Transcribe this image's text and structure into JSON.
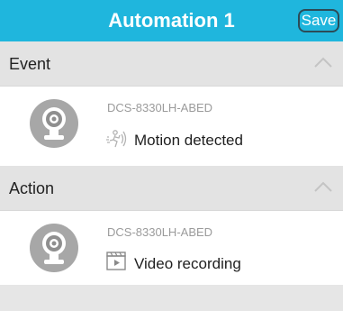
{
  "header": {
    "title": "Automation 1",
    "save_label": "Save",
    "background_color": "#1fb6dd"
  },
  "event_section": {
    "label": "Event",
    "collapse_icon": "chevron-up-icon",
    "item": {
      "device": "DCS-8330LH-ABED",
      "detail": "Motion detected",
      "icon": "motion-icon",
      "avatar_icon": "camera-icon"
    }
  },
  "action_section": {
    "label": "Action",
    "collapse_icon": "chevron-up-icon",
    "item": {
      "device": "DCS-8330LH-ABED",
      "detail": "Video recording",
      "icon": "video-recording-icon",
      "avatar_icon": "camera-icon"
    }
  }
}
